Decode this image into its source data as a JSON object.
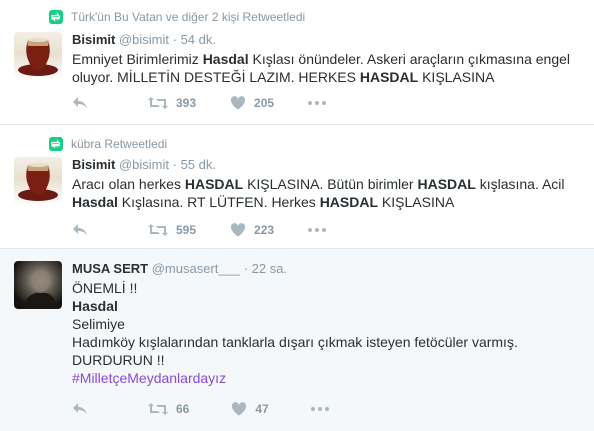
{
  "colors": {
    "retweet_green": "#19cf86",
    "hashtag_purple": "#8c4ad6",
    "meta_gray": "#8899a6",
    "text_dark": "#292f33",
    "highlight_bg": "#f5f8fa"
  },
  "tweets": [
    {
      "retweeted_by": "Türk'ün Bu Vatan ve diğer 2 kişi Retweetledi",
      "author": {
        "name": "Bisimit",
        "handle": "@bisimit",
        "time": "· 54 dk."
      },
      "body": [
        {
          "t": "Emniyet Birimlerimiz ",
          "b": false
        },
        {
          "t": "Hasdal",
          "b": true
        },
        {
          "t": " Kışlası önündeler. Askeri araçların çıkmasına engel oluyor. MİLLETİN DESTEĞİ LAZIM. HERKES ",
          "b": false
        },
        {
          "t": "HASDAL",
          "b": true
        },
        {
          "t": " KIŞLASINA",
          "b": false
        }
      ],
      "retweets": "393",
      "likes": "205",
      "icons": [
        "reply-icon",
        "retweet-icon",
        "heart-icon",
        "more-icon"
      ]
    },
    {
      "retweeted_by": "kübra Retweetledi",
      "author": {
        "name": "Bisimit",
        "handle": "@bisimit",
        "time": "· 55 dk."
      },
      "body": [
        {
          "t": "Aracı olan herkes ",
          "b": false
        },
        {
          "t": "HASDAL",
          "b": true
        },
        {
          "t": " KIŞLASINA. Bütün birimler ",
          "b": false
        },
        {
          "t": "HASDAL",
          "b": true
        },
        {
          "t": " kışlasına. Acil ",
          "b": false
        },
        {
          "t": "Hasdal",
          "b": true
        },
        {
          "t": " Kışlasına. RT LÜTFEN. Herkes ",
          "b": false
        },
        {
          "t": "HASDAL",
          "b": true
        },
        {
          "t": " KIŞLASINA",
          "b": false
        }
      ],
      "retweets": "595",
      "likes": "223",
      "icons": [
        "reply-icon",
        "retweet-icon",
        "heart-icon",
        "more-icon"
      ]
    },
    {
      "retweeted_by": "",
      "author": {
        "name": "MUSA SERT",
        "handle": "@musasert___",
        "time": "· 22 sa."
      },
      "lines": {
        "l1": "ÖNEMLİ !!",
        "l2": "Hasdal",
        "l3": "Selimiye",
        "l4": "Hadımköy kışlalarından tanklarla dışarı çıkmak isteyen fetöcüler varmış.",
        "l5": "DURDURUN !!",
        "hashtag": "#MilletçeMeydanlardayız"
      },
      "retweets": "66",
      "likes": "47",
      "icons": [
        "reply-icon",
        "retweet-icon",
        "heart-icon",
        "more-icon"
      ]
    }
  ]
}
